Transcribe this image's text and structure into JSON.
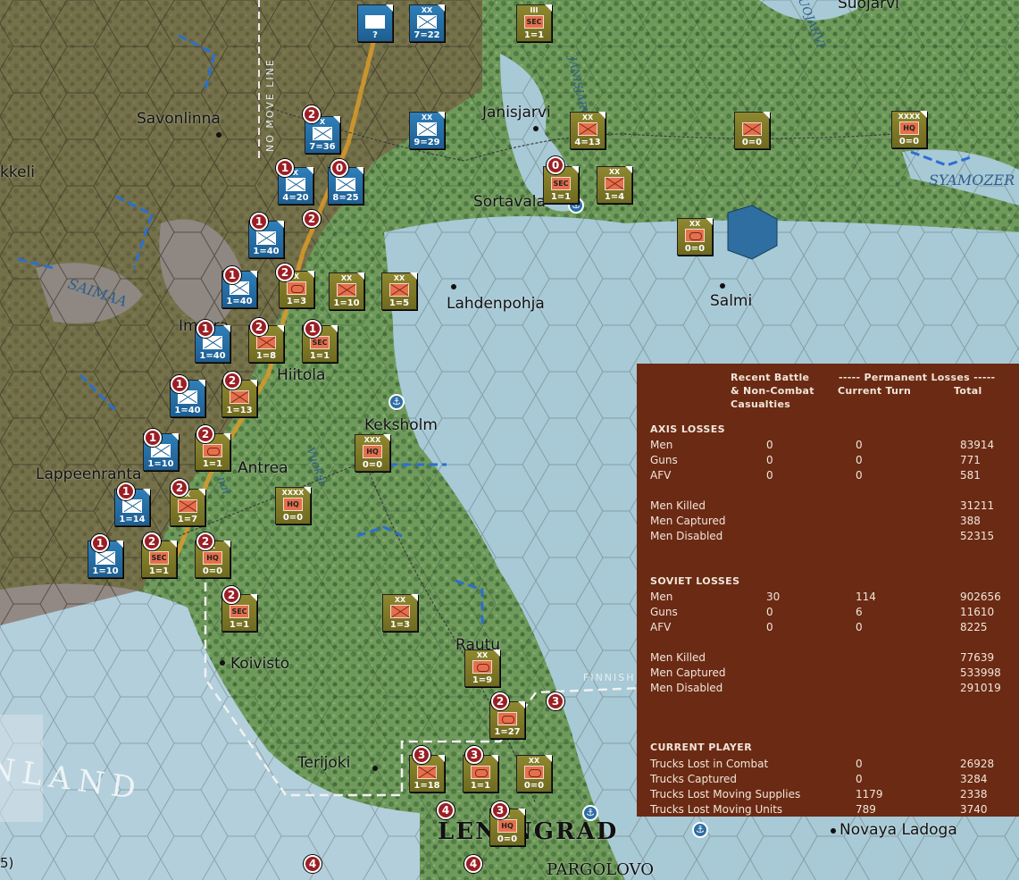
{
  "map": {
    "places": [
      "Savonlinna",
      "kkeli",
      "Janisjarvi",
      "Sortavala",
      "Suojarvi",
      "Lahdenpohja",
      "Salmi",
      "Imatra",
      "Hiitola",
      "Keksholm",
      "Lappeenranta",
      "Antrea",
      "Koivisto",
      "Rautu",
      "Terijoki",
      "Novaya Ladoga",
      "LENINGRAD",
      "PARGOLOVO"
    ],
    "sea_labels": [
      "SAIMAA",
      "SUOJARVI",
      "JANISJARVI",
      "SYAMOZER",
      "Vuoksi",
      "nal"
    ],
    "overlay_labels": [
      "NO MOVE LINE",
      "FINNISH"
    ],
    "country_label": "NLAND",
    "edge_label": "5)"
  },
  "units": [
    {
      "side": "axis",
      "size": "",
      "type": "unknown",
      "str": "?"
    },
    {
      "side": "axis",
      "size": "XX",
      "type": "inf",
      "str": "7=22"
    },
    {
      "side": "soviet",
      "size": "III",
      "type": "sec",
      "str": "1=1"
    },
    {
      "side": "axis",
      "size": "X",
      "type": "inf",
      "str": "7=36"
    },
    {
      "side": "axis",
      "size": "XX",
      "type": "inf",
      "str": "9=29"
    },
    {
      "side": "soviet",
      "size": "XX",
      "type": "inf",
      "str": "4=13"
    },
    {
      "side": "soviet",
      "size": "",
      "type": "inf",
      "str": "0=0"
    },
    {
      "side": "soviet",
      "size": "XXXX",
      "type": "hq",
      "str": "0=0"
    },
    {
      "side": "axis",
      "size": "X",
      "type": "inf",
      "str": "4=20"
    },
    {
      "side": "axis",
      "size": "",
      "type": "inf",
      "str": "8=25"
    },
    {
      "side": "soviet",
      "size": "",
      "type": "sec",
      "str": "1=1"
    },
    {
      "side": "soviet",
      "size": "XX",
      "type": "inf",
      "str": "1=4"
    },
    {
      "side": "axis",
      "size": "",
      "type": "inf",
      "str": "1=40"
    },
    {
      "side": "soviet",
      "size": "XX",
      "type": "arm",
      "str": "0=0"
    },
    {
      "side": "axis",
      "size": "",
      "type": "inf",
      "str": "1=40"
    },
    {
      "side": "soviet",
      "size": "X",
      "type": "arm",
      "str": "1=3"
    },
    {
      "side": "soviet",
      "size": "XX",
      "type": "inf",
      "str": "1=10"
    },
    {
      "side": "soviet",
      "size": "XX",
      "type": "inf",
      "str": "1=5"
    },
    {
      "side": "axis",
      "size": "",
      "type": "inf",
      "str": "1=40"
    },
    {
      "side": "soviet",
      "size": "",
      "type": "inf",
      "str": "1=8"
    },
    {
      "side": "soviet",
      "size": "",
      "type": "sec",
      "str": "1=1"
    },
    {
      "side": "axis",
      "size": "",
      "type": "inf",
      "str": "1=40"
    },
    {
      "side": "soviet",
      "size": "",
      "type": "inf",
      "str": "1=13"
    },
    {
      "side": "axis",
      "size": "",
      "type": "inf",
      "str": "1=10"
    },
    {
      "side": "soviet",
      "size": "",
      "type": "arm",
      "str": "1=1"
    },
    {
      "side": "soviet",
      "size": "XXX",
      "type": "hq",
      "str": "0=0"
    },
    {
      "side": "axis",
      "size": "",
      "type": "inf",
      "str": "1=14"
    },
    {
      "side": "soviet",
      "size": "X",
      "type": "inf",
      "str": "1=7"
    },
    {
      "side": "soviet",
      "size": "XXXX",
      "type": "hq",
      "str": "0=0"
    },
    {
      "side": "axis",
      "size": "",
      "type": "inf",
      "str": "1=10"
    },
    {
      "side": "soviet",
      "size": "",
      "type": "sec",
      "str": "1=1"
    },
    {
      "side": "soviet",
      "size": "X",
      "type": "hq",
      "str": "0=0"
    },
    {
      "side": "soviet",
      "size": "",
      "type": "sec",
      "str": "1=1"
    },
    {
      "side": "soviet",
      "size": "XX",
      "type": "inf",
      "str": "1=3"
    },
    {
      "side": "soviet",
      "size": "XX",
      "type": "arm",
      "str": "1=9"
    },
    {
      "side": "soviet",
      "size": "",
      "type": "arm",
      "str": "1=27"
    },
    {
      "side": "soviet",
      "size": "",
      "type": "inf",
      "str": "1=18"
    },
    {
      "side": "soviet",
      "size": "",
      "type": "arm",
      "str": "1=1"
    },
    {
      "side": "soviet",
      "size": "XX",
      "type": "arm",
      "str": "0=0"
    },
    {
      "side": "soviet",
      "size": "X",
      "type": "hq",
      "str": "0=0"
    }
  ],
  "markers": [
    "2",
    "1",
    "0",
    "2",
    "1",
    "1",
    "2",
    "1",
    "2",
    "1",
    "1",
    "2",
    "1",
    "2",
    "1",
    "2",
    "2",
    "2",
    "2",
    "1",
    "3",
    "3",
    "3",
    "4",
    "4",
    "4",
    "3",
    "2",
    "0"
  ],
  "panel": {
    "headers": {
      "col1a": "Recent Battle",
      "col1b": "& Non-Combat",
      "col1c": "Casualties",
      "perm": "----- Permanent Losses -----",
      "col2": "Current Turn",
      "col3": "Total"
    },
    "axis": {
      "title": "AXIS LOSSES",
      "rows": [
        {
          "label": "Men",
          "recent": "0",
          "turn": "0",
          "total": "83914"
        },
        {
          "label": "Guns",
          "recent": "0",
          "turn": "0",
          "total": "771"
        },
        {
          "label": "AFV",
          "recent": "0",
          "turn": "0",
          "total": "581"
        }
      ],
      "detail": [
        {
          "label": "Men Killed",
          "total": "31211"
        },
        {
          "label": "Men Captured",
          "total": "388"
        },
        {
          "label": "Men Disabled",
          "total": "52315"
        }
      ]
    },
    "soviet": {
      "title": "SOVIET LOSSES",
      "rows": [
        {
          "label": "Men",
          "recent": "30",
          "turn": "114",
          "total": "902656"
        },
        {
          "label": "Guns",
          "recent": "0",
          "turn": "6",
          "total": "11610"
        },
        {
          "label": "AFV",
          "recent": "0",
          "turn": "0",
          "total": "8225"
        }
      ],
      "detail": [
        {
          "label": "Men Killed",
          "total": "77639"
        },
        {
          "label": "Men Captured",
          "total": "533998"
        },
        {
          "label": "Men Disabled",
          "total": "291019"
        }
      ]
    },
    "current": {
      "title": "CURRENT PLAYER",
      "rows": [
        {
          "label": "Trucks Lost in Combat",
          "turn": "0",
          "total": "26928"
        },
        {
          "label": "Trucks Captured",
          "turn": "0",
          "total": "3284"
        },
        {
          "label": "Trucks Lost Moving Supplies",
          "turn": "1179",
          "total": "2338"
        },
        {
          "label": "Trucks Lost Moving Units",
          "turn": "789",
          "total": "3740"
        }
      ]
    }
  },
  "colors": {
    "axis_unit": "#1d5e92",
    "soviet_unit": "#6f6a1f",
    "panel_bg": "#6b2a14",
    "forest": "#5d8a4a",
    "lake": "#9ec3d3",
    "finland_zone": "#8c6a52"
  }
}
